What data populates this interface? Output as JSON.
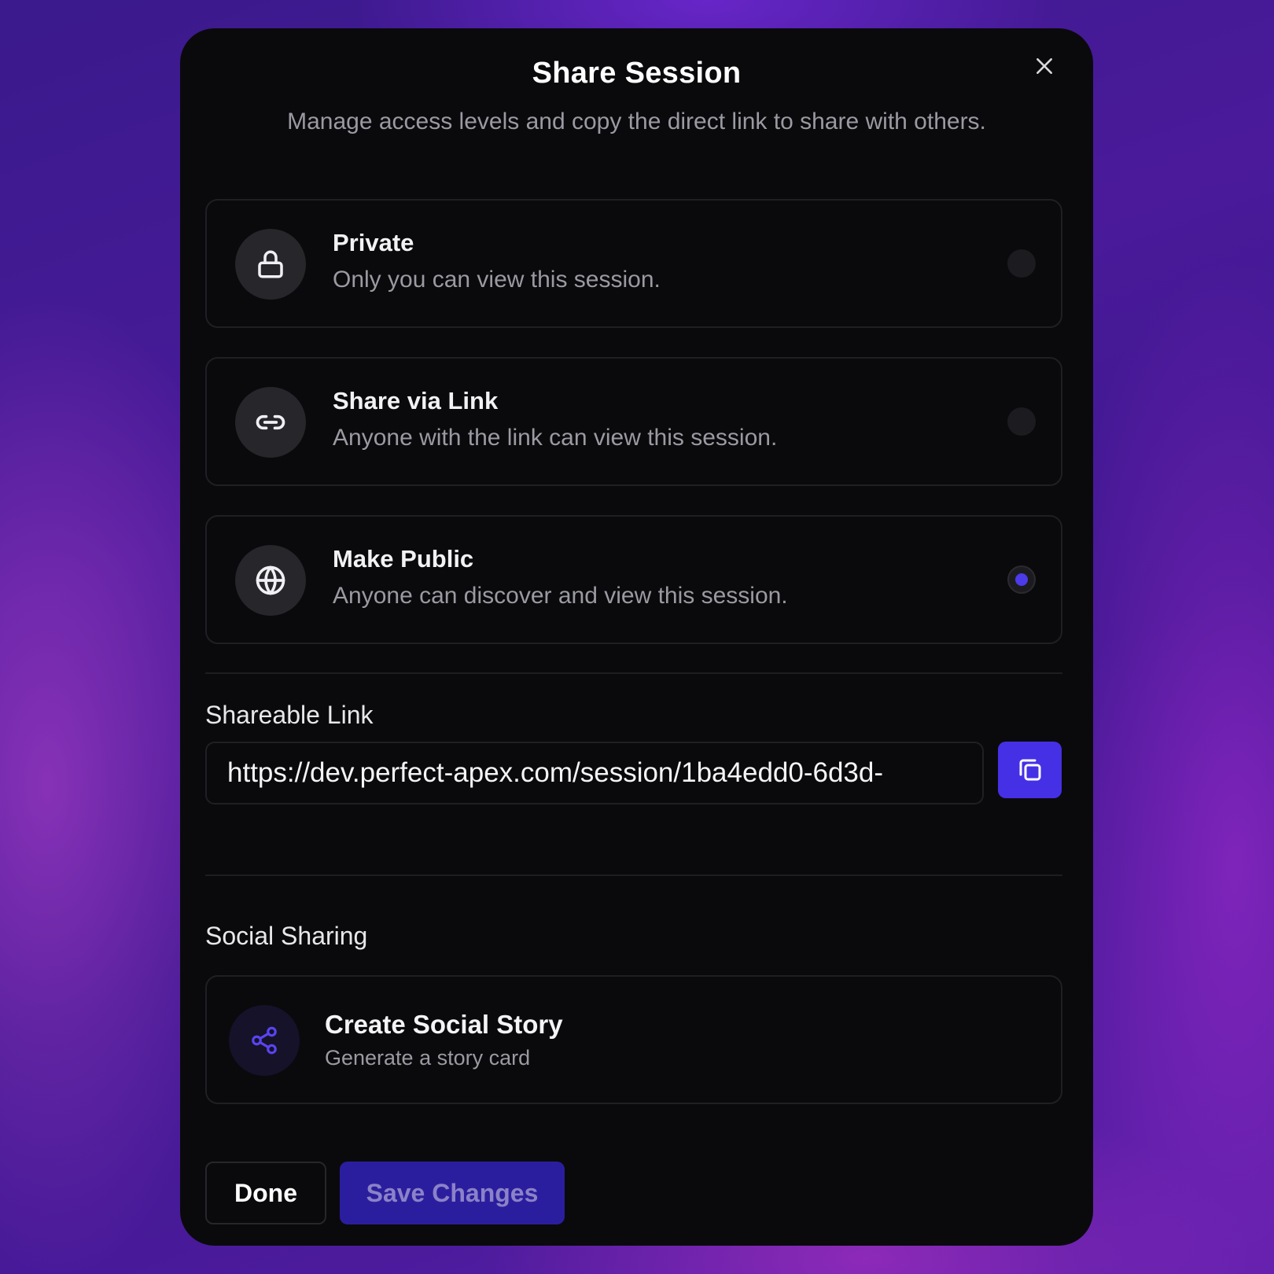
{
  "dialog": {
    "title": "Share Session",
    "subtitle": "Manage access levels and copy the direct link to share with others.",
    "close_icon": "close-icon"
  },
  "access_options": [
    {
      "id": "private",
      "title": "Private",
      "description": "Only you can view this session.",
      "icon": "lock-icon",
      "selected": false
    },
    {
      "id": "link",
      "title": "Share via Link",
      "description": "Anyone with the link can view this session.",
      "icon": "link-icon",
      "selected": false
    },
    {
      "id": "public",
      "title": "Make Public",
      "description": "Anyone can discover and view this session.",
      "icon": "globe-icon",
      "selected": true
    }
  ],
  "shareable_link": {
    "label": "Shareable Link",
    "value": "https://dev.perfect-apex.com/session/1ba4edd0-6d3d-",
    "copy_icon": "copy-icon"
  },
  "social": {
    "label": "Social Sharing",
    "card_title": "Create Social Story",
    "card_description": "Generate a story card",
    "icon": "share-icon"
  },
  "footer": {
    "done_label": "Done",
    "save_label": "Save Changes"
  },
  "colors": {
    "accent": "#4530e6",
    "modal_bg": "#0a0a0c",
    "save_bg": "#2b1e9e"
  }
}
